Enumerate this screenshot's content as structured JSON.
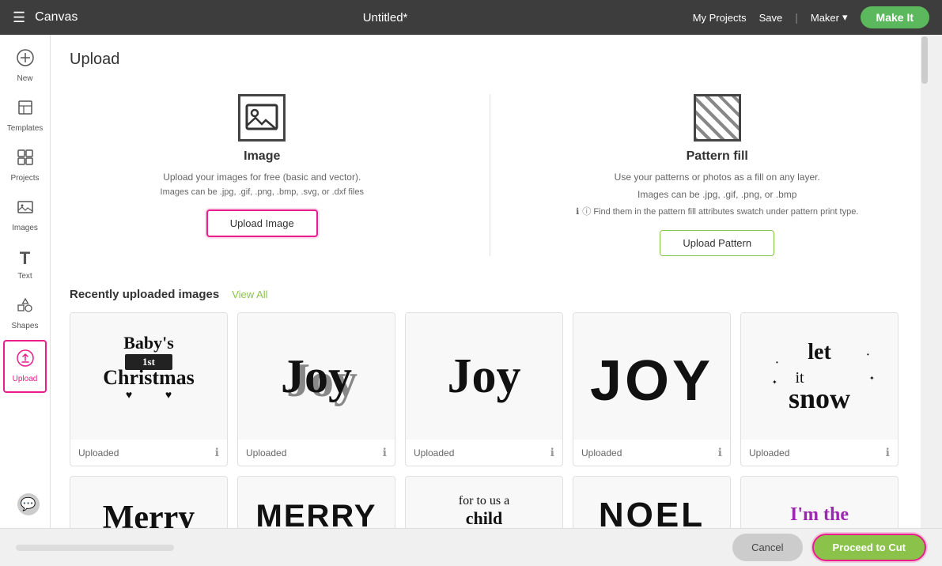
{
  "topbar": {
    "brand": "Canvas",
    "title": "Untitled*",
    "my_projects": "My Projects",
    "save": "Save",
    "maker": "Maker",
    "make_it": "Make It"
  },
  "sidebar": {
    "items": [
      {
        "id": "new",
        "label": "New",
        "icon": "➕"
      },
      {
        "id": "templates",
        "label": "Templates",
        "icon": "👕"
      },
      {
        "id": "projects",
        "label": "Projects",
        "icon": "⊞"
      },
      {
        "id": "images",
        "label": "Images",
        "icon": "🖼"
      },
      {
        "id": "text",
        "label": "Text",
        "icon": "T"
      },
      {
        "id": "shapes",
        "label": "Shapes",
        "icon": "✦"
      },
      {
        "id": "upload",
        "label": "Upload",
        "icon": "⬆"
      }
    ]
  },
  "upload_panel": {
    "title": "Upload",
    "image_section": {
      "title": "Image",
      "desc1": "Upload your images for free (basic and vector).",
      "desc2": "Images can be .jpg, .gif, .png, .bmp, .svg, or .dxf files",
      "btn_label": "Upload Image"
    },
    "pattern_section": {
      "title": "Pattern fill",
      "desc1": "Use your patterns or photos as a fill on any layer.",
      "desc2": "Images can be .jpg, .gif, .png, or .bmp",
      "note": "ⓘ Find them in the pattern fill attributes swatch under pattern print type.",
      "btn_label": "Upload Pattern"
    },
    "recently": {
      "title": "Recently uploaded images",
      "view_all": "View All"
    },
    "images": [
      {
        "label": "Uploaded"
      },
      {
        "label": "Uploaded"
      },
      {
        "label": "Uploaded"
      },
      {
        "label": "Uploaded"
      },
      {
        "label": "Uploaded"
      }
    ],
    "images_row2": [
      {
        "label": ""
      },
      {
        "label": ""
      },
      {
        "label": ""
      },
      {
        "label": ""
      },
      {
        "label": ""
      }
    ]
  },
  "bottom_bar": {
    "cancel": "Cancel",
    "proceed": "Proceed to Cut"
  },
  "colors": {
    "accent_green": "#8bc34a",
    "accent_pink": "#e91e8c"
  }
}
